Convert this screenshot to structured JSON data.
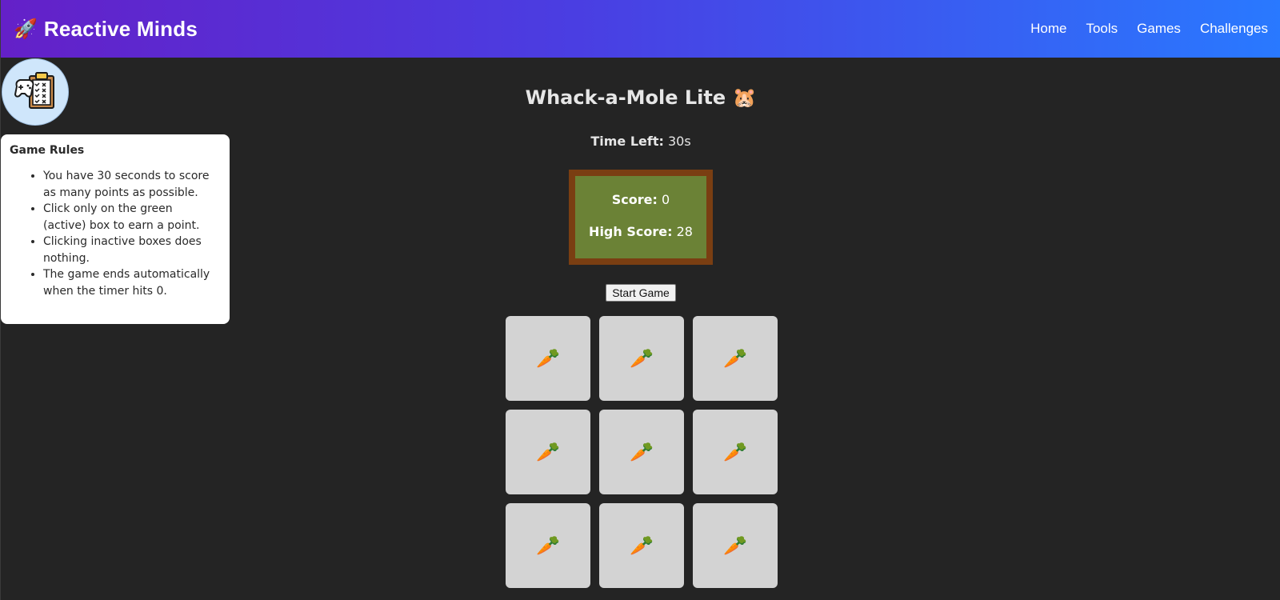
{
  "header": {
    "brand_icon": "🚀",
    "brand_text": "Reactive Minds",
    "nav": [
      "Home",
      "Tools",
      "Games",
      "Challenges"
    ]
  },
  "avatar": {
    "icon": "clipboard-gamepad-icon"
  },
  "rules": {
    "title": "Game Rules",
    "items": [
      "You have 30 seconds to score as many points as possible.",
      "Click only on the green (active) box to earn a point.",
      "Clicking inactive boxes does nothing.",
      "The game ends automatically when the timer hits 0."
    ]
  },
  "game": {
    "title": "Whack-a-Mole Lite 🐹",
    "timer_label": "Time Left:",
    "timer_value": "30s",
    "score_label": "Score:",
    "score_value": "0",
    "high_score_label": "High Score:",
    "high_score_value": "28",
    "start_button": "Start Game",
    "cells": [
      "🥕",
      "🥕",
      "🥕",
      "🥕",
      "🥕",
      "🥕",
      "🥕",
      "🥕",
      "🥕"
    ]
  },
  "colors": {
    "header_start": "#6420c8",
    "header_end": "#2979ff",
    "background": "#242424",
    "scoreboard_fill": "#6b8236",
    "scoreboard_border": "#7a3e12",
    "cell": "#d3d3d3"
  }
}
